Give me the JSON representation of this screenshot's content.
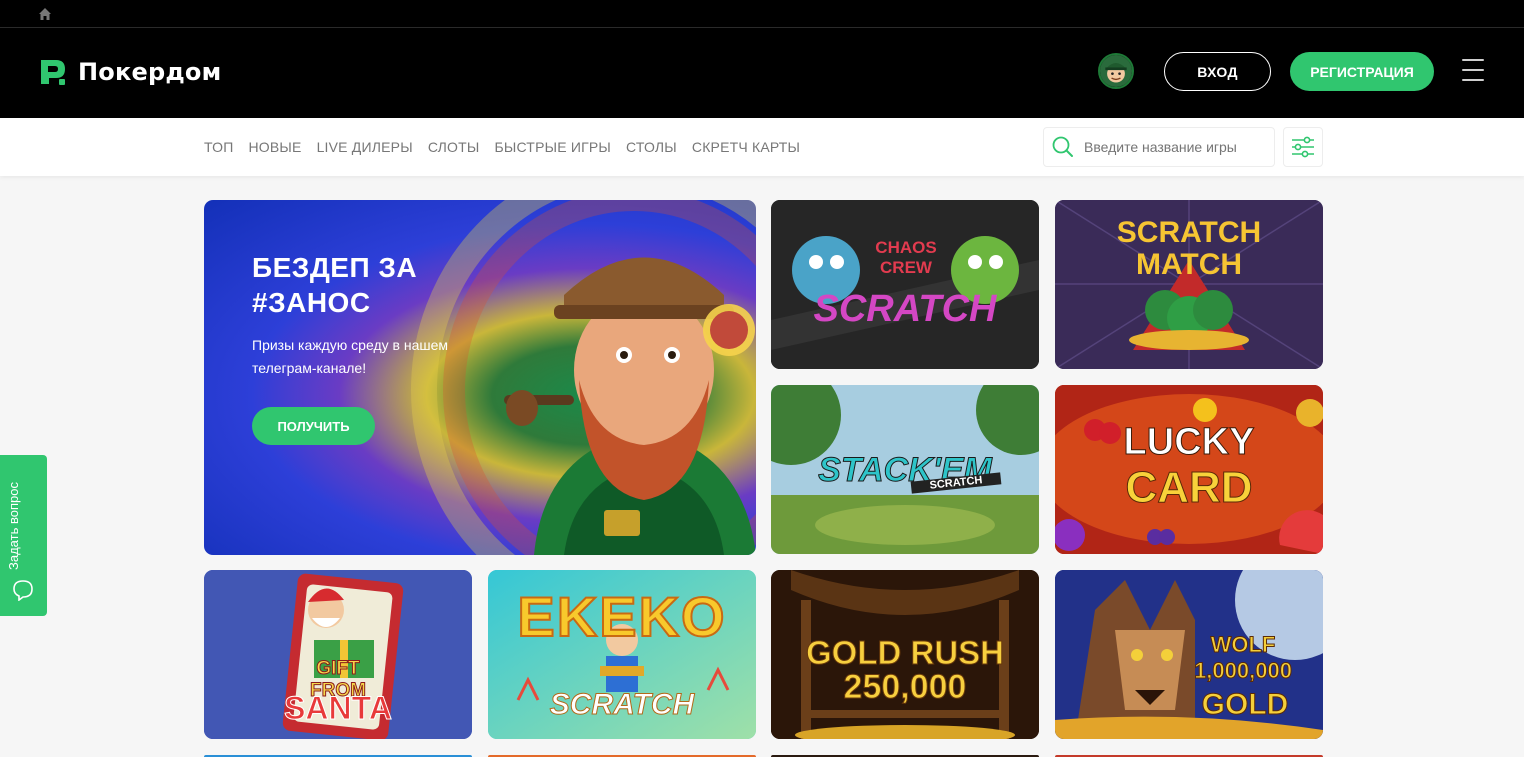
{
  "brand": {
    "name": "Покердом",
    "accent": "#30c66f"
  },
  "header": {
    "login_label": "ВХОД",
    "register_label": "РЕГИСТРАЦИЯ"
  },
  "icons": [
    "home-icon",
    "logo-icon",
    "avatar",
    "menu-icon",
    "search-icon",
    "filter-icon",
    "chat-icon"
  ],
  "categories": [
    "ТОП",
    "НОВЫЕ",
    "LIVE ДИЛЕРЫ",
    "СЛОТЫ",
    "БЫСТРЫЕ ИГРЫ",
    "СТОЛЫ",
    "СКРЕТЧ КАРТЫ"
  ],
  "search": {
    "placeholder": "Введите название игры"
  },
  "banner": {
    "title": "БЕЗДЕП ЗА #ЗАНОС",
    "subtitle": "Призы каждую среду в нашем телеграм-канале!",
    "button_label": "ПОЛУЧИТЬ"
  },
  "games": [
    {
      "line1": "CHAOS CREW",
      "line2": "SCRATCH"
    },
    {
      "line1": "SCRATCH",
      "line2": "MATCH"
    },
    {
      "line1": "STACK'EM",
      "line2": "SCRATCH"
    },
    {
      "line1": "LUCKY",
      "line2": "CARD"
    },
    {
      "line1": "GIFT FROM",
      "line2": "SANTA"
    },
    {
      "line1": "EKEKO",
      "line2": "SCRATCH"
    },
    {
      "line1": "GOLD RUSH",
      "line2": "250,000"
    },
    {
      "line1": "WOLF 1,000,000",
      "line2": "GOLD"
    }
  ],
  "support": {
    "label": "Задать вопрос"
  }
}
